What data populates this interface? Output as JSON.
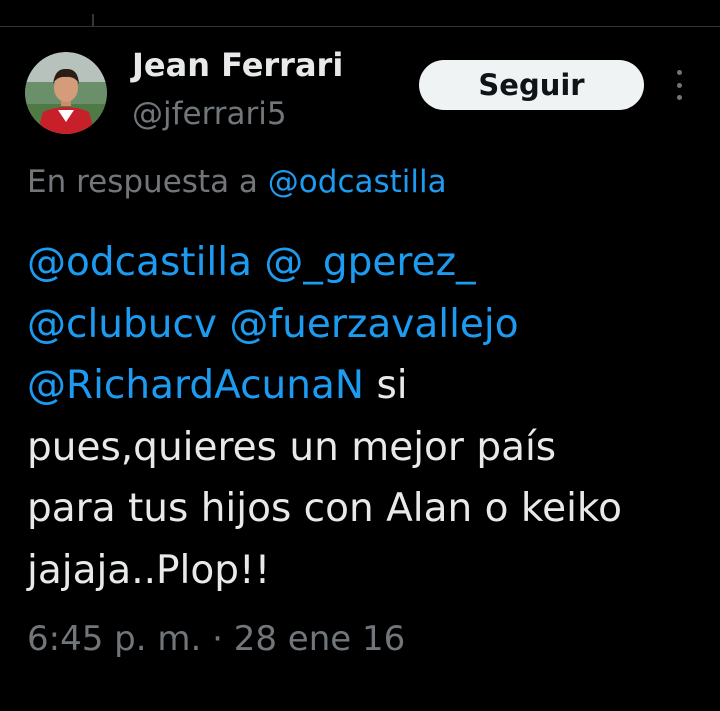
{
  "author": {
    "name": "Jean Ferrari",
    "handle": "@jferrari5",
    "avatar_icon": "user-avatar-photo"
  },
  "follow_button": {
    "label": "Seguir"
  },
  "more_menu": {
    "icon": "vertical-ellipsis-icon"
  },
  "reply_context": {
    "prefix": "En respuesta a",
    "mention": "@odcastilla"
  },
  "tweet": {
    "mentions": [
      "@odcastilla",
      "@_gperez_",
      "@clubucv",
      "@fuerzavallejo",
      "@RichardAcunaN"
    ],
    "text_after_mentions": "si",
    "lines": [
      "pues,quieres un mejor país",
      "para tus hijos con Alan o keiko",
      "jajaja..Plop!!"
    ]
  },
  "meta": {
    "time": "6:45 p. m.",
    "separator": "·",
    "date": "28 ene 16"
  },
  "colors": {
    "background": "#000000",
    "text_primary": "#e7e9ea",
    "text_secondary": "#71767b",
    "link": "#1d9bf0",
    "button_bg": "#eff3f4",
    "button_text": "#0f1419"
  }
}
